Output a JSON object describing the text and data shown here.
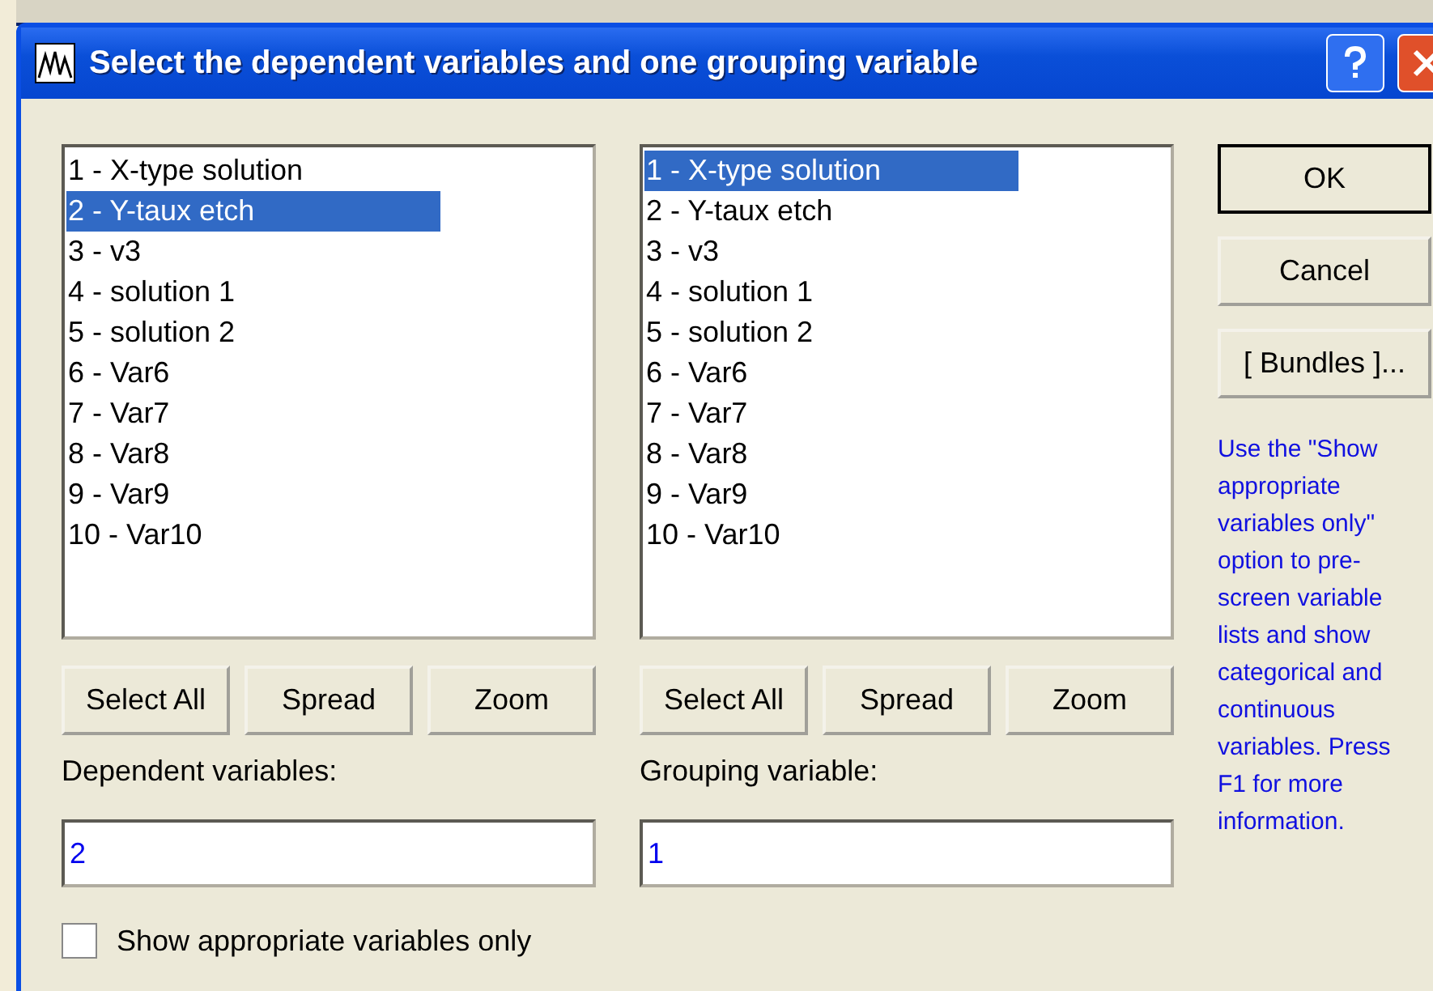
{
  "window": {
    "title": "Select the dependent variables and one grouping variable"
  },
  "panels": [
    {
      "items": [
        {
          "label": "1 - X-type solution",
          "selected": false
        },
        {
          "label": "2 - Y-taux etch",
          "selected": true
        },
        {
          "label": "3 - v3",
          "selected": false
        },
        {
          "label": "4 - solution 1",
          "selected": false
        },
        {
          "label": "5 - solution 2",
          "selected": false
        },
        {
          "label": "6 - Var6",
          "selected": false
        },
        {
          "label": "7 - Var7",
          "selected": false
        },
        {
          "label": "8 - Var8",
          "selected": false
        },
        {
          "label": "9 - Var9",
          "selected": false
        },
        {
          "label": "10 - Var10",
          "selected": false
        }
      ],
      "buttons": [
        "Select All",
        "Spread",
        "Zoom"
      ],
      "field_label": "Dependent variables:",
      "field_value": "2"
    },
    {
      "items": [
        {
          "label": "1 - X-type solution",
          "selected": true
        },
        {
          "label": "2 - Y-taux etch",
          "selected": false
        },
        {
          "label": "3 - v3",
          "selected": false
        },
        {
          "label": "4 - solution 1",
          "selected": false
        },
        {
          "label": "5 - solution 2",
          "selected": false
        },
        {
          "label": "6 - Var6",
          "selected": false
        },
        {
          "label": "7 - Var7",
          "selected": false
        },
        {
          "label": "8 - Var8",
          "selected": false
        },
        {
          "label": "9 - Var9",
          "selected": false
        },
        {
          "label": "10 - Var10",
          "selected": false
        }
      ],
      "buttons": [
        "Select All",
        "Spread",
        "Zoom"
      ],
      "field_label": "Grouping variable:",
      "field_value": "1"
    }
  ],
  "side_buttons": [
    "OK",
    "Cancel",
    "[ Bundles ]..."
  ],
  "hint": "Use the \"Show appropriate variables only\" option to pre-screen variable lists and show categorical and continuous variables. Press F1 for more information.",
  "checkbox": {
    "label": "Show appropriate variables only",
    "checked": false
  }
}
